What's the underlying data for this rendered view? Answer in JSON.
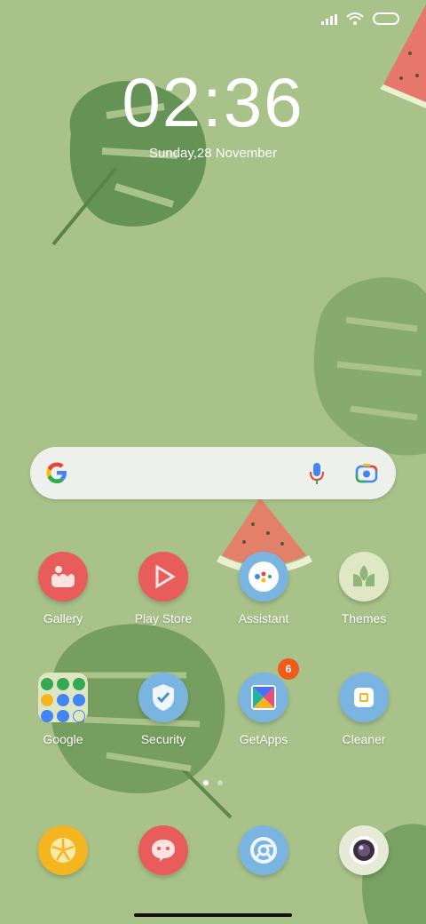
{
  "status": {
    "signal_icon": "signal-icon",
    "wifi_icon": "wifi-icon",
    "battery_icon": "battery-icon"
  },
  "clock": {
    "time": "02:36",
    "date": "Sunday,28 November"
  },
  "search": {
    "logo": "google-g-icon",
    "mic": "mic-icon",
    "lens": "lens-icon"
  },
  "apps": [
    {
      "label": "Gallery",
      "icon": "gallery-icon",
      "color": "#e85c5c"
    },
    {
      "label": "Play Store",
      "icon": "play-store-icon",
      "color": "#e85c5c"
    },
    {
      "label": "Assistant",
      "icon": "assistant-icon",
      "color": "#7ab4e0"
    },
    {
      "label": "Themes",
      "icon": "themes-icon",
      "color": "#dfe8c4"
    },
    {
      "label": "Google",
      "icon": "google-folder-icon"
    },
    {
      "label": "Security",
      "icon": "security-icon",
      "color": "#7ab4e0"
    },
    {
      "label": "GetApps",
      "icon": "getapps-icon",
      "color": "#7ab4e0",
      "badge": "6"
    },
    {
      "label": "Cleaner",
      "icon": "cleaner-icon",
      "color": "#7ab4e0"
    }
  ],
  "dock": [
    {
      "icon": "lemon-icon",
      "color": "#f4b520"
    },
    {
      "icon": "chat-icon",
      "color": "#e85c5c"
    },
    {
      "icon": "chrome-icon",
      "color": "#7ab4e0"
    },
    {
      "icon": "camera-icon",
      "color": "#e8ead8"
    }
  ],
  "page_indicator": {
    "pages": 2,
    "active": 1
  },
  "colors": {
    "background": "#a8c28a",
    "badge": "#f05a1a"
  }
}
